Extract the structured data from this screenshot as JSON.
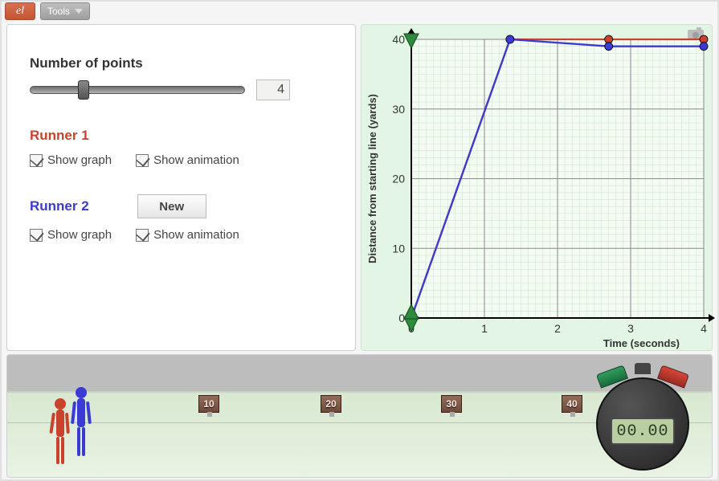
{
  "toolbar": {
    "logo_text": "el",
    "tools_label": "Tools"
  },
  "controls": {
    "points_heading": "Number of points",
    "points_value": "4",
    "slider_min": 2,
    "slider_max": 10,
    "slider_pos_pct": 22,
    "runner1": {
      "title": "Runner 1",
      "show_graph_label": "Show graph",
      "show_anim_label": "Show animation",
      "show_graph": true,
      "show_anim": true
    },
    "runner2": {
      "title": "Runner 2",
      "show_graph_label": "Show graph",
      "show_anim_label": "Show animation",
      "show_graph": true,
      "show_anim": true
    },
    "new_button": "New"
  },
  "track": {
    "markers": [
      "10",
      "20",
      "30",
      "40"
    ],
    "runner1_x": 52,
    "runner2_x": 78,
    "stopwatch_value": "00.00"
  },
  "chart_data": {
    "type": "line",
    "xlabel": "Time (seconds)",
    "ylabel": "Distance from starting line (yards)",
    "xlim": [
      0,
      4
    ],
    "ylim": [
      0,
      40
    ],
    "xticks": [
      0,
      1,
      2,
      3,
      4
    ],
    "yticks": [
      0,
      10,
      20,
      30,
      40
    ],
    "series": [
      {
        "name": "Runner 1",
        "color": "#c9432c",
        "x": [
          0,
          1.35,
          2.7,
          4
        ],
        "y": [
          0,
          40,
          40,
          40
        ]
      },
      {
        "name": "Runner 2",
        "color": "#3a3ad4",
        "x": [
          0,
          1.35,
          2.7,
          4
        ],
        "y": [
          0,
          40,
          39,
          39
        ]
      }
    ],
    "origin_handle": {
      "x": 0,
      "y": 0
    },
    "top_handle": {
      "x": 0,
      "y": 40
    }
  }
}
